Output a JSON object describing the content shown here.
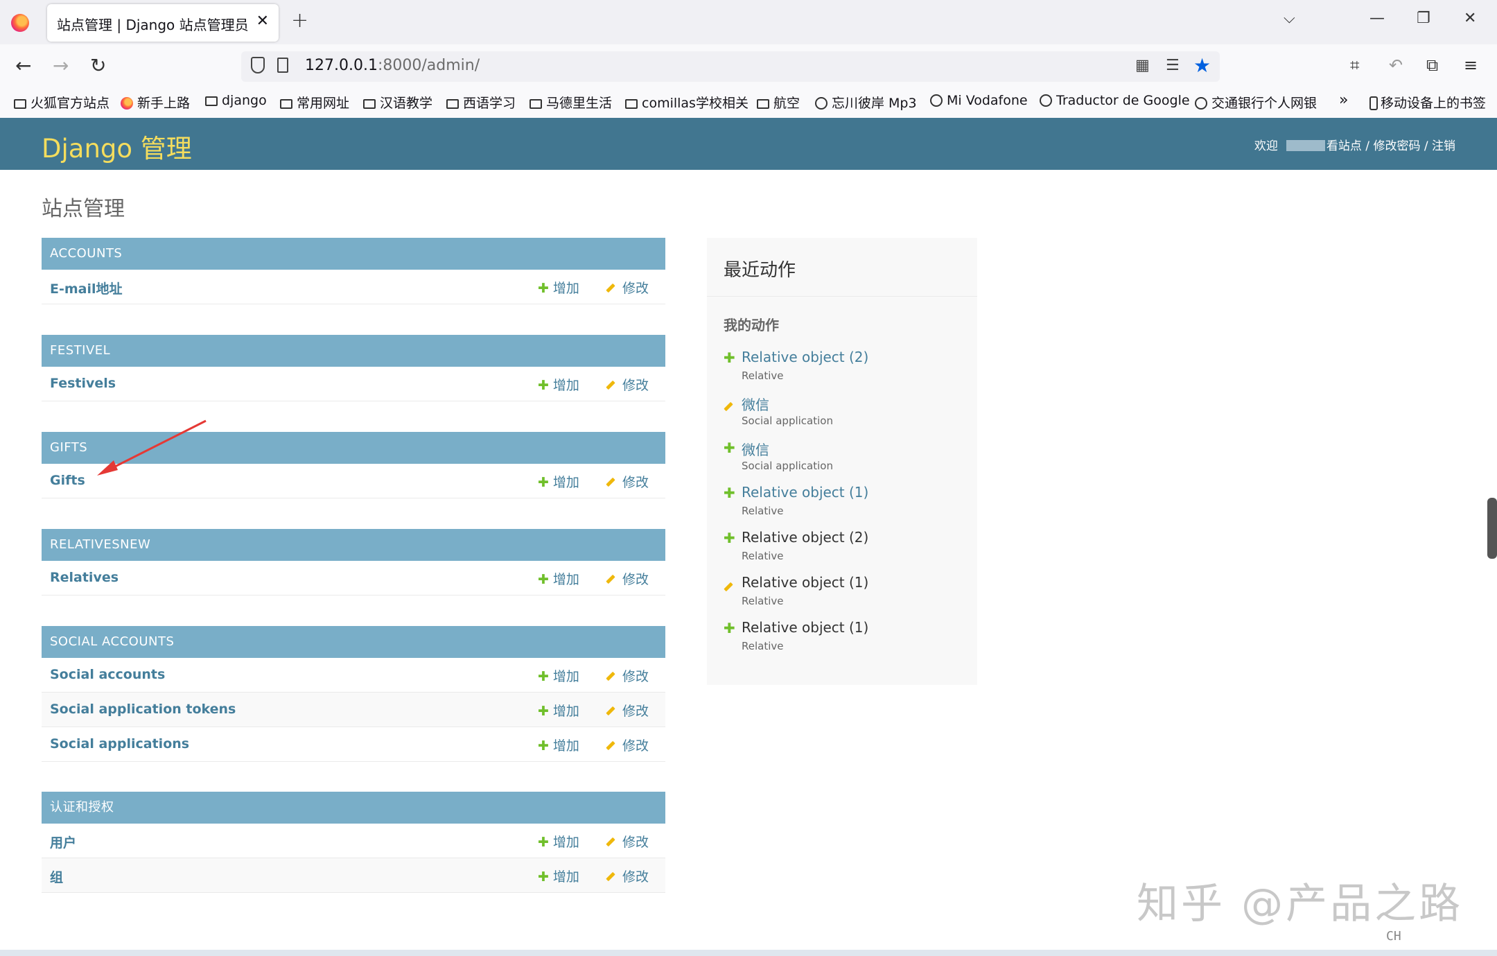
{
  "browser": {
    "tab_title": "站点管理 | Django 站点管理员",
    "url_host": "127.0.0.1",
    "url_rest": ":8000/admin/",
    "bookmarks": [
      {
        "label": "火狐官方站点",
        "icon": "firefox-icon"
      },
      {
        "label": "新手上路",
        "icon": "firefox-icon"
      },
      {
        "label": "django",
        "icon": "folder-icon"
      },
      {
        "label": "常用网址",
        "icon": "folder-icon"
      },
      {
        "label": "汉语教学",
        "icon": "folder-icon"
      },
      {
        "label": "西语学习",
        "icon": "folder-icon"
      },
      {
        "label": "马德里生活",
        "icon": "folder-icon"
      },
      {
        "label": "comillas学校相关",
        "icon": "folder-icon"
      },
      {
        "label": "航空",
        "icon": "folder-icon"
      },
      {
        "label": "忘川彼岸 Mp3",
        "icon": "globe-icon"
      },
      {
        "label": "Mi Vodafone",
        "icon": "globe-icon"
      },
      {
        "label": "Traductor de Google",
        "icon": "globe-icon"
      },
      {
        "label": "交通银行个人网银",
        "icon": "globe-icon"
      }
    ],
    "mobile_bookmarks": "移动设备上的书签"
  },
  "header": {
    "brand": "Django 管理",
    "welcome": "欢迎",
    "view_site": "看站点",
    "sep": " / ",
    "change_password": "修改密码",
    "logout": "注销"
  },
  "page_title": "站点管理",
  "modules": [
    {
      "caption": "ACCOUNTS",
      "rows": [
        {
          "name": "E-mail地址"
        }
      ]
    },
    {
      "caption": "FESTIVEL",
      "rows": [
        {
          "name": "Festivels"
        }
      ]
    },
    {
      "caption": "GIFTS",
      "rows": [
        {
          "name": "Gifts"
        }
      ]
    },
    {
      "caption": "RELATIVESNEW",
      "rows": [
        {
          "name": "Relatives"
        }
      ]
    },
    {
      "caption": "SOCIAL ACCOUNTS",
      "rows": [
        {
          "name": "Social accounts"
        },
        {
          "name": "Social application tokens"
        },
        {
          "name": "Social applications"
        }
      ]
    },
    {
      "caption": "认证和授权",
      "rows": [
        {
          "name": "用户"
        },
        {
          "name": "组"
        }
      ]
    }
  ],
  "actions": {
    "add": "增加",
    "change": "修改"
  },
  "recent": {
    "title": "最近动作",
    "subtitle": "我的动作",
    "items": [
      {
        "mark": "add",
        "name": "Relative object (2)",
        "type": "Relative",
        "linked": true
      },
      {
        "mark": "change",
        "name": "微信",
        "type": "Social application",
        "linked": true
      },
      {
        "mark": "add",
        "name": "微信",
        "type": "Social application",
        "linked": true
      },
      {
        "mark": "add",
        "name": "Relative object (1)",
        "type": "Relative",
        "linked": true
      },
      {
        "mark": "add",
        "name": "Relative object (2)",
        "type": "Relative",
        "linked": false
      },
      {
        "mark": "change",
        "name": "Relative object (1)",
        "type": "Relative",
        "linked": false
      },
      {
        "mark": "add",
        "name": "Relative object (1)",
        "type": "Relative",
        "linked": false
      }
    ]
  },
  "colors": {
    "header": "#417690",
    "brand": "#f5dd5d",
    "caption": "#79aec8",
    "link": "#447e9b",
    "add": "#70bf2b",
    "change": "#efb80b",
    "annotation": "#e53935"
  },
  "watermark": "知乎 @产品之路",
  "ime": "CH"
}
